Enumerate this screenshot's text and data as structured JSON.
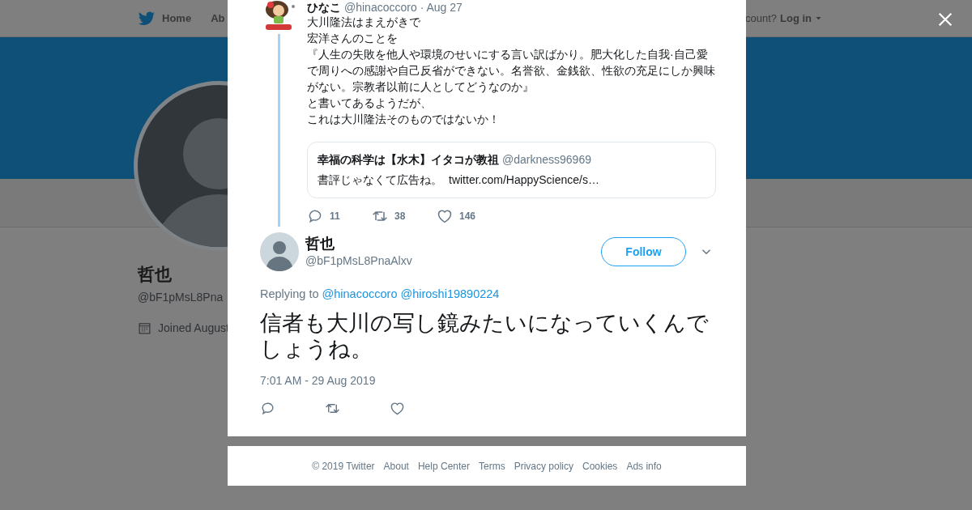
{
  "background": {
    "nav": {
      "items": [
        {
          "label": "Home",
          "kind": "home"
        },
        {
          "label": "Ab",
          "kind": "plain"
        }
      ],
      "account_prompt": "count?",
      "login": "Log in"
    },
    "profile": {
      "name": "哲也",
      "handle": "@bF1pMsL8Pna",
      "joined": "Joined August"
    }
  },
  "modal": {
    "parent_tweet": {
      "author": "ひなこ",
      "handle": "@hinacoccoro",
      "time": "· Aug 27",
      "lines": [
        "大川隆法はまえがきで",
        "宏洋さんのことを",
        "『人生の失敗を他人や環境のせいにする言い訳ばかり。肥大化した自我·自己愛で周りへの感謝や自己反省ができない。名誉欲、金銭欲、性欲の充足にしか興味がない。宗教者以前に人としてどうなのか』",
        "と書いてあるようだが、",
        "これは大川隆法そのものではないか！"
      ],
      "quote": {
        "author": "幸福の科学は【水木】イタコが教祖",
        "handle": "@darkness96969",
        "text": "書評じゃなくて広告ね。",
        "link": "twitter.com/HappyScience/s…"
      },
      "actions": [
        {
          "kind": "reply",
          "count": "11"
        },
        {
          "kind": "retweet",
          "count": "38"
        },
        {
          "kind": "like",
          "count": "146"
        }
      ]
    },
    "focus_tweet": {
      "author": "哲也",
      "handle": "@bF1pMsL8PnaAlxv",
      "follow": "Follow",
      "replying_label": "Replying to",
      "replying_to": [
        "@hinacoccoro",
        "@hiroshi19890224"
      ],
      "text": "信者も大川の写し鏡みたいになっていくんでしょうね。",
      "timestamp": "7:01 AM - 29 Aug 2019",
      "actions": [
        {
          "kind": "reply"
        },
        {
          "kind": "retweet"
        },
        {
          "kind": "like"
        }
      ]
    }
  },
  "footer": {
    "copyright": "© 2019 Twitter",
    "links": [
      "About",
      "Help Center",
      "Terms",
      "Privacy policy",
      "Cookies",
      "Ads info"
    ]
  }
}
